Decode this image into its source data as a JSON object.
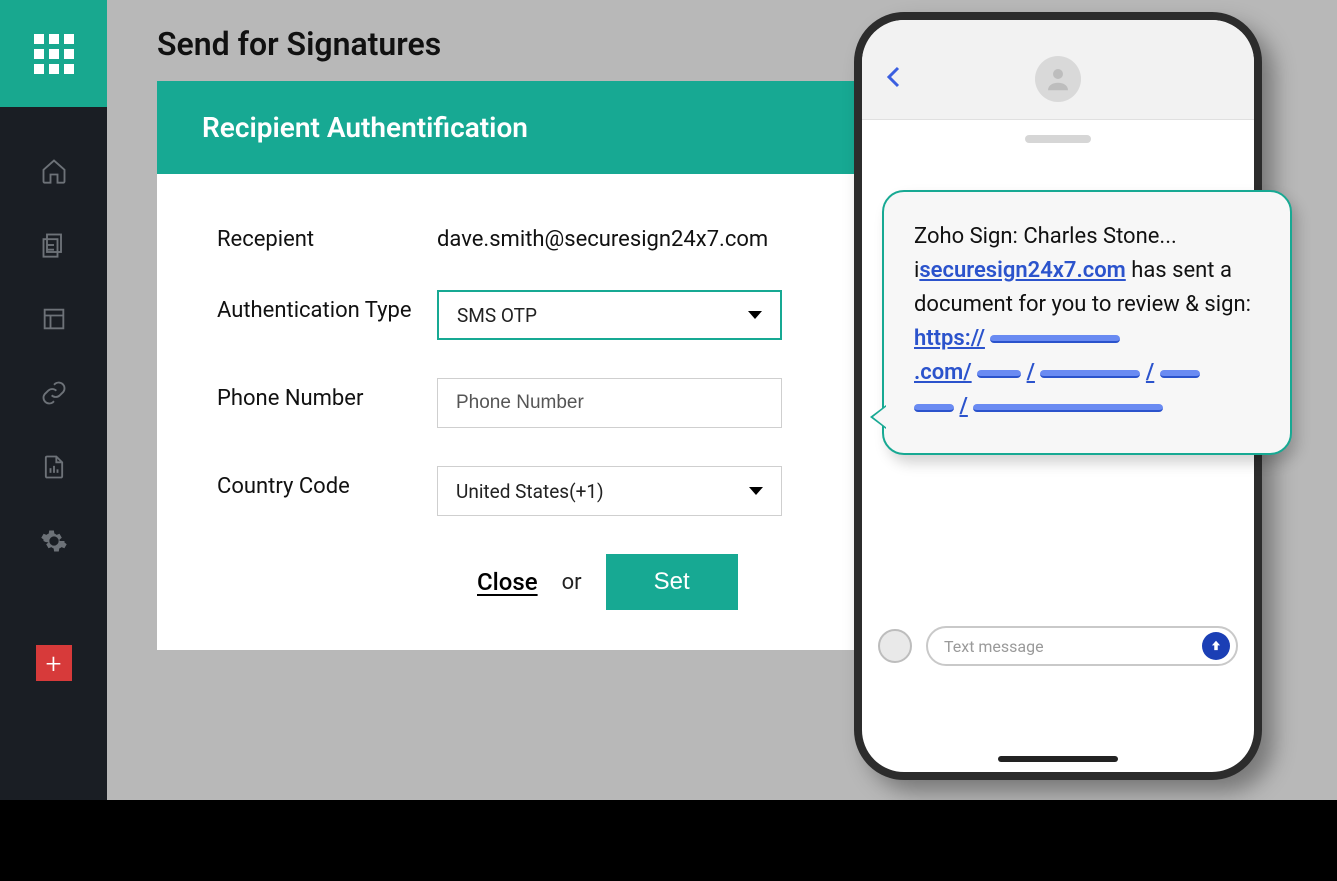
{
  "page": {
    "title": "Send for Signatures"
  },
  "modal": {
    "title": "Recipient Authentification",
    "recipient_label": "Recepient",
    "recipient_value": "dave.smith@securesign24x7.com",
    "auth_label": "Authentication Type",
    "auth_value": "SMS OTP",
    "phone_label": "Phone Number",
    "phone_placeholder": "Phone Number",
    "country_label": "Country Code",
    "country_value": "United States(+1)",
    "close": "Close",
    "or": "or",
    "set": "Set"
  },
  "phone": {
    "msg_prefix": "Zoho Sign: Charles Stone... i",
    "msg_domain": "securesign24x7.com",
    "msg_mid": " has sent a document for you to review & sign: ",
    "msg_https": "https://",
    "msg_dotcom": ".com/",
    "text_placeholder": "Text message"
  },
  "colors": {
    "accent": "#17a993",
    "link": "#2b53cc"
  }
}
